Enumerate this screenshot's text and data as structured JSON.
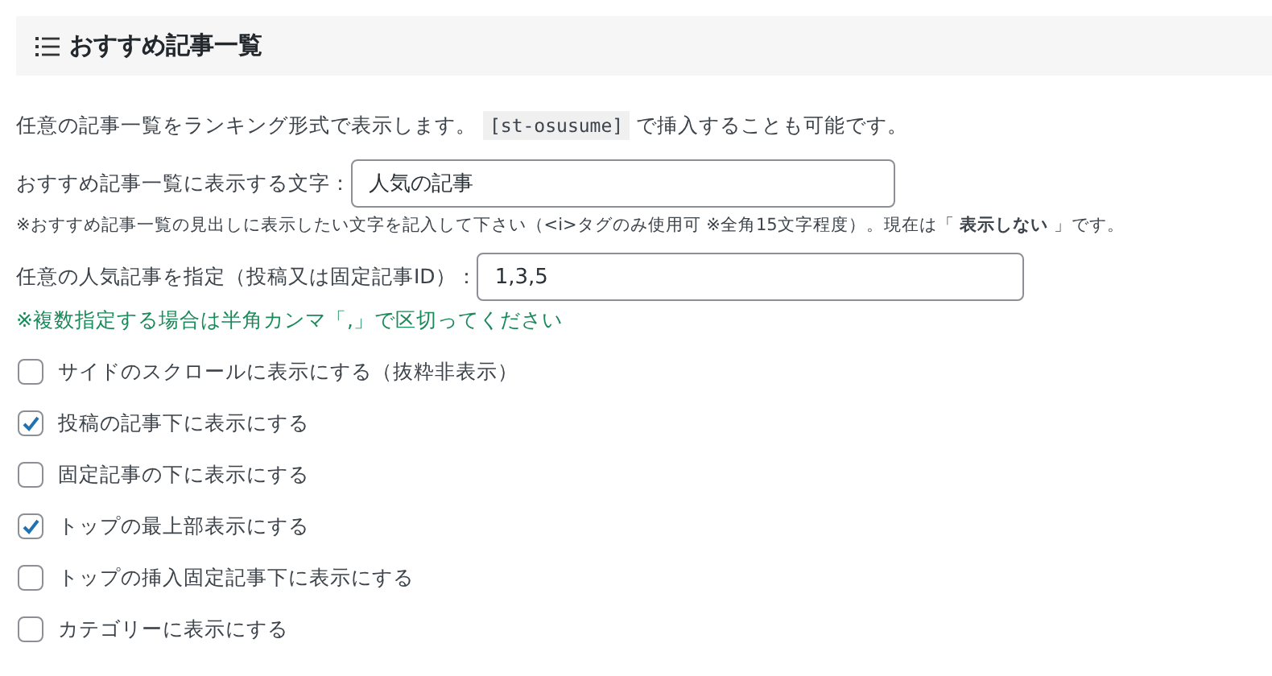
{
  "section": {
    "title": "おすすめ記事一覧"
  },
  "intro": {
    "before": "任意の記事一覧をランキング形式で表示します。",
    "code": "[st-osusume]",
    "after": "で挿入することも可能です。"
  },
  "fields": [
    {
      "label": "おすすめ記事一覧に表示する文字：",
      "value": "人気の記事",
      "hint": "※おすすめ記事一覧の見出しに表示したい文字を記入して下さい（<i>タグのみ使用可 ※全角15文字程度）。現在は「 **表示しない** 」です。",
      "kind": "note"
    },
    {
      "label": "任意の人気記事を指定（投稿又は固定記事ID）：",
      "value": "1,3,5",
      "hint": "※複数指定する場合は半角カンマ「,」で区切ってください",
      "kind": "notice"
    }
  ],
  "options": [
    {
      "label": "サイドのスクロールに表示にする（抜粋非表示）",
      "checked": false
    },
    {
      "label": "投稿の記事下に表示にする",
      "checked": true
    },
    {
      "label": "固定記事の下に表示にする",
      "checked": false
    },
    {
      "label": "トップの最上部表示にする",
      "checked": true
    },
    {
      "label": "トップの挿入固定記事下に表示にする",
      "checked": false
    },
    {
      "label": "カテゴリーに表示にする",
      "checked": false
    }
  ]
}
